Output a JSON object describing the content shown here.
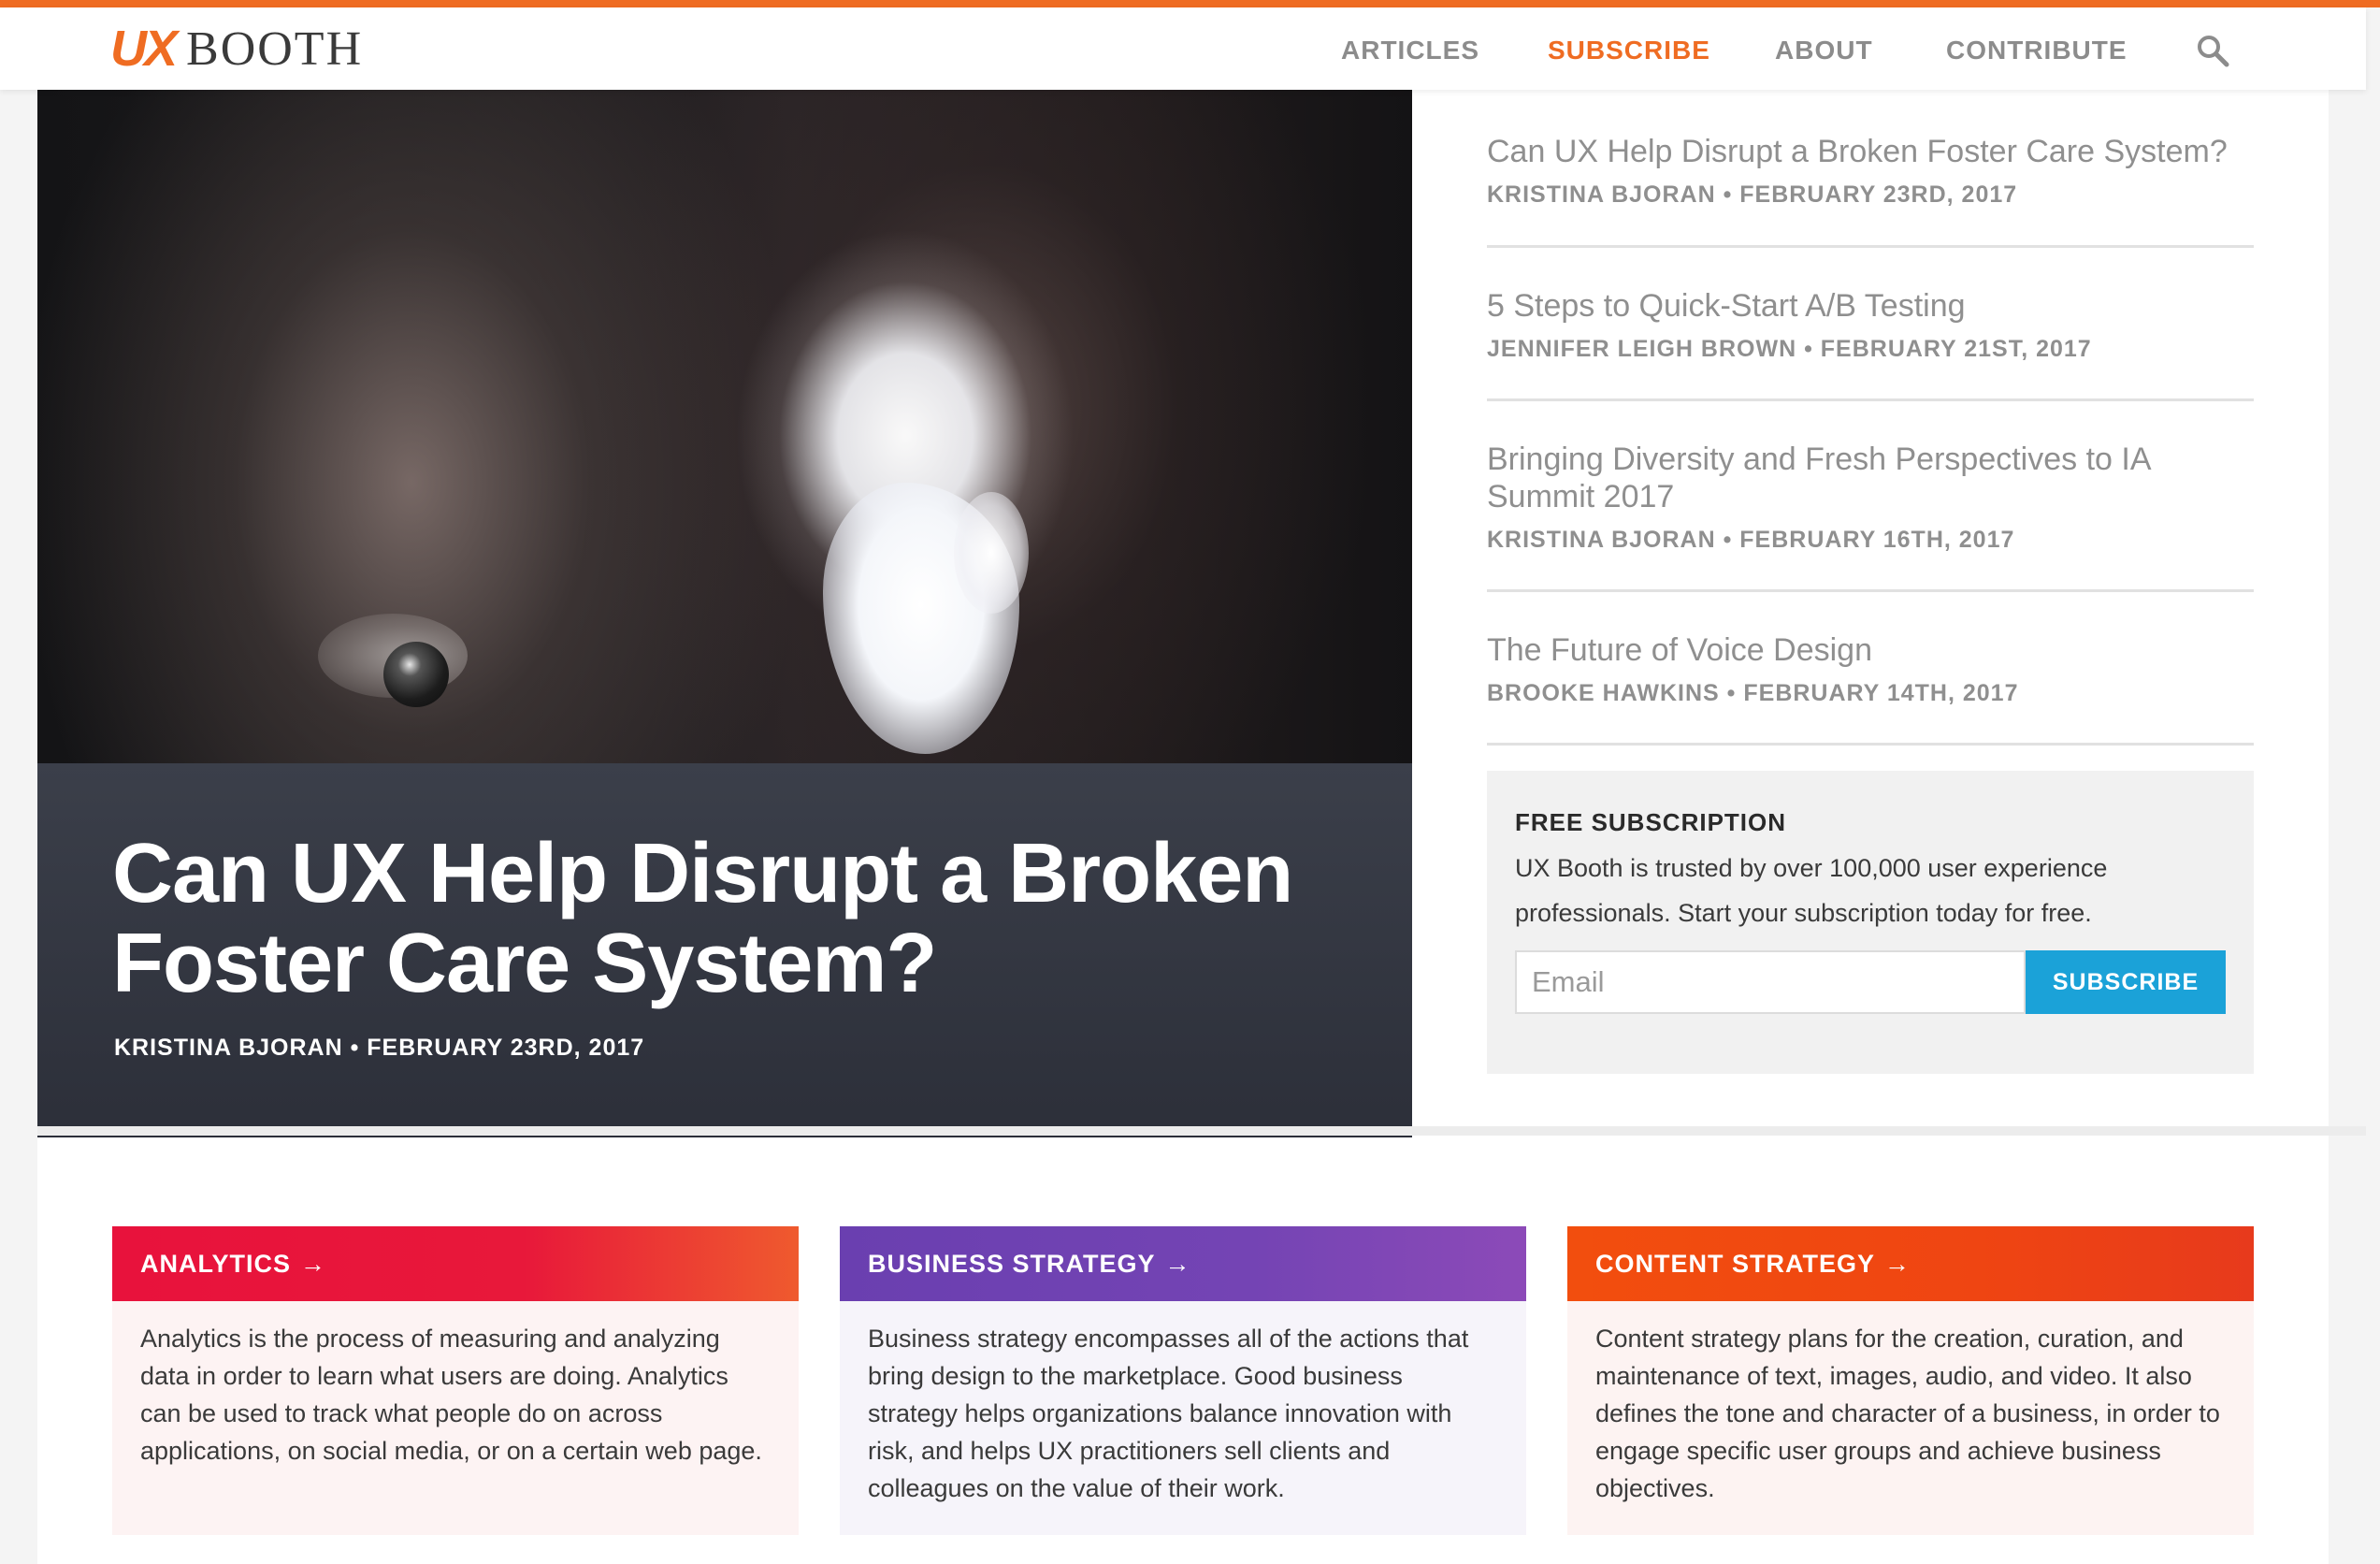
{
  "header": {
    "logo_mark": "UX",
    "logo_text": "BOOTH",
    "nav": [
      "ARTICLES",
      "SUBSCRIBE",
      "ABOUT",
      "CONTRIBUTE"
    ],
    "active_nav": "SUBSCRIBE",
    "accent_color": "#ef6c22"
  },
  "hero": {
    "title": "Can UX Help Disrupt a Broken Foster Care System?",
    "meta": "KRISTINA BJORAN • FEBRUARY 23RD, 2017"
  },
  "sidebar": {
    "articles": [
      {
        "title": "Can UX Help Disrupt a Broken Foster Care System?",
        "meta": "KRISTINA BJORAN • FEBRUARY 23RD, 2017"
      },
      {
        "title": "5 Steps to Quick-Start A/B Testing",
        "meta": "JENNIFER LEIGH BROWN • FEBRUARY 21ST, 2017"
      },
      {
        "title": "Bringing Diversity and Fresh Perspectives to IA Summit 2017",
        "meta": "KRISTINA BJORAN • FEBRUARY 16TH, 2017"
      },
      {
        "title": "The Future of Voice Design",
        "meta": "BROOKE HAWKINS • FEBRUARY 14TH, 2017"
      }
    ]
  },
  "subscription": {
    "heading": "FREE SUBSCRIPTION",
    "text": "UX Booth is trusted by over 100,000 user experience professionals. Start your subscription today for free.",
    "email_placeholder": "Email",
    "button_label": "SUBSCRIBE",
    "button_color": "#1ba2d8"
  },
  "categories": [
    {
      "label": "ANALYTICS",
      "arrow": "→",
      "text": "Analytics is the process of measuring and analyzing data in order to learn what users are doing. Analytics can be used to track what people do on across applications, on social media, or on a certain web page.",
      "colors": [
        "#e8123c",
        "#ef5a2e"
      ]
    },
    {
      "label": "BUSINESS STRATEGY",
      "arrow": "→",
      "text": "Business strategy encompasses all of the actions that bring design to the marketplace. Good business strategy helps organizations balance innovation with risk, and helps UX practitioners sell clients and colleagues on the value of their work.",
      "colors": [
        "#6a3fb0",
        "#8c4ab8"
      ]
    },
    {
      "label": "CONTENT STRATEGY",
      "arrow": "→",
      "text": "Content strategy plans for the creation, curation, and maintenance of text, images, audio, and video. It also defines the tone and character of a business, in order to engage specific user groups and achieve business objectives.",
      "colors": [
        "#f24e0e",
        "#e73a1c"
      ]
    }
  ]
}
